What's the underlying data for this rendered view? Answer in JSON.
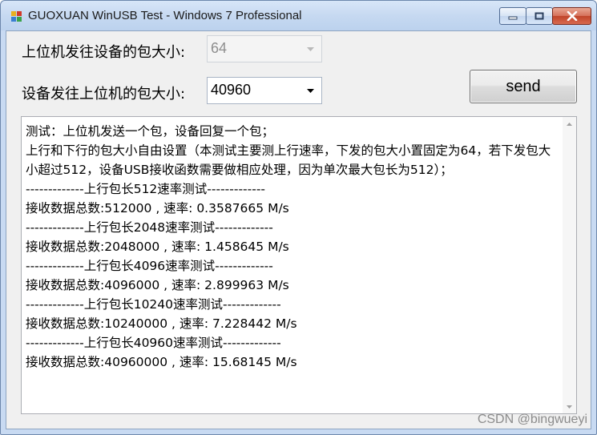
{
  "window": {
    "title": "GUOXUAN WinUSB Test - Windows 7 Professional",
    "icon": "app-colored-squares-icon"
  },
  "form": {
    "host_to_device_label": "上位机发往设备的包大小:",
    "host_to_device_value": "64",
    "device_to_host_label": "设备发往上位机的包大小:",
    "device_to_host_value": "40960",
    "send_label": "send"
  },
  "log": {
    "lines": [
      "测试：上位机发送一个包，设备回复一个包；",
      "上行和下行的包大小自由设置（本测试主要测上行速率，下发的包大小置固定为64，若下发包大小超过512，设备USB接收函数需要做相应处理，因为单次最大包长为512）；",
      "-------------上行包长512速率测试-------------",
      "接收数据总数:512000 , 速率: 0.3587665 M/s",
      "-------------上行包长2048速率测试-------------",
      "接收数据总数:2048000 , 速率: 1.458645 M/s",
      "-------------上行包长4096速率测试-------------",
      "接收数据总数:4096000 , 速率: 2.899963 M/s",
      "-------------上行包长10240速率测试-------------",
      "接收数据总数:10240000 , 速率: 7.228442 M/s",
      "-------------上行包长40960速率测试-------------",
      "接收数据总数:40960000 , 速率: 15.68145 M/s"
    ]
  },
  "watermark": "CSDN @bingwueyi"
}
